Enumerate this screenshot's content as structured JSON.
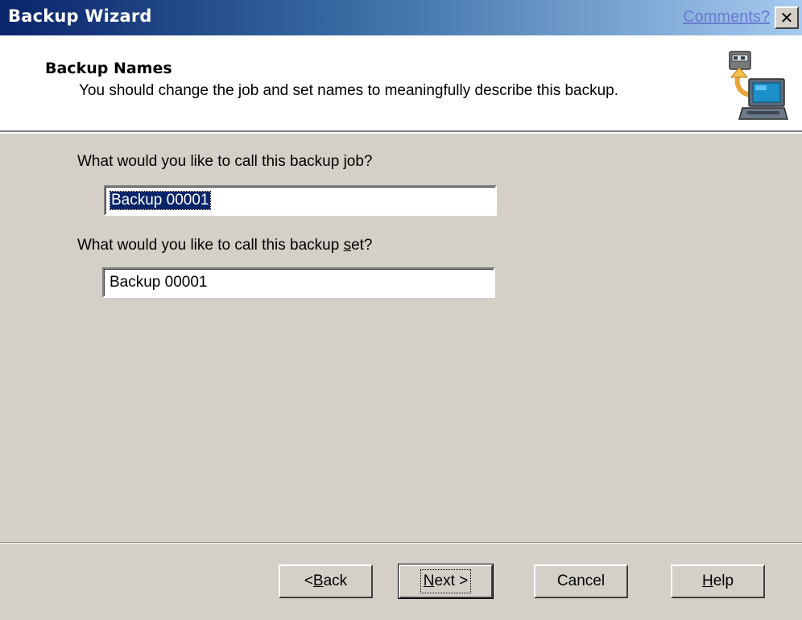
{
  "window": {
    "title": "Backup Wizard",
    "comments_link": "Comments?",
    "close_glyph": "✕"
  },
  "header": {
    "title": "Backup Names",
    "subtitle": "You should change the job and set names to meaningfully describe this backup.",
    "icon": "backup-computer-icon"
  },
  "form": {
    "job_question_pre": "What would you like to call this backup ",
    "job_question_accel": "j",
    "job_question_post": "ob?",
    "job_name_value": "Backup 00001",
    "set_question_pre": "What would you like to call this backup ",
    "set_question_accel": "s",
    "set_question_post": "et?",
    "set_name_value": "Backup 00001"
  },
  "buttons": {
    "back_pre": "< ",
    "back_accel": "B",
    "back_post": "ack",
    "next_accel": "N",
    "next_post": "ext >",
    "cancel": "Cancel",
    "help_accel": "H",
    "help_post": "elp"
  },
  "colors": {
    "titlebar_start": "#0a246a",
    "titlebar_end": "#a6caf0",
    "dialog_face": "#d4d0c8",
    "selection": "#0a246a"
  }
}
